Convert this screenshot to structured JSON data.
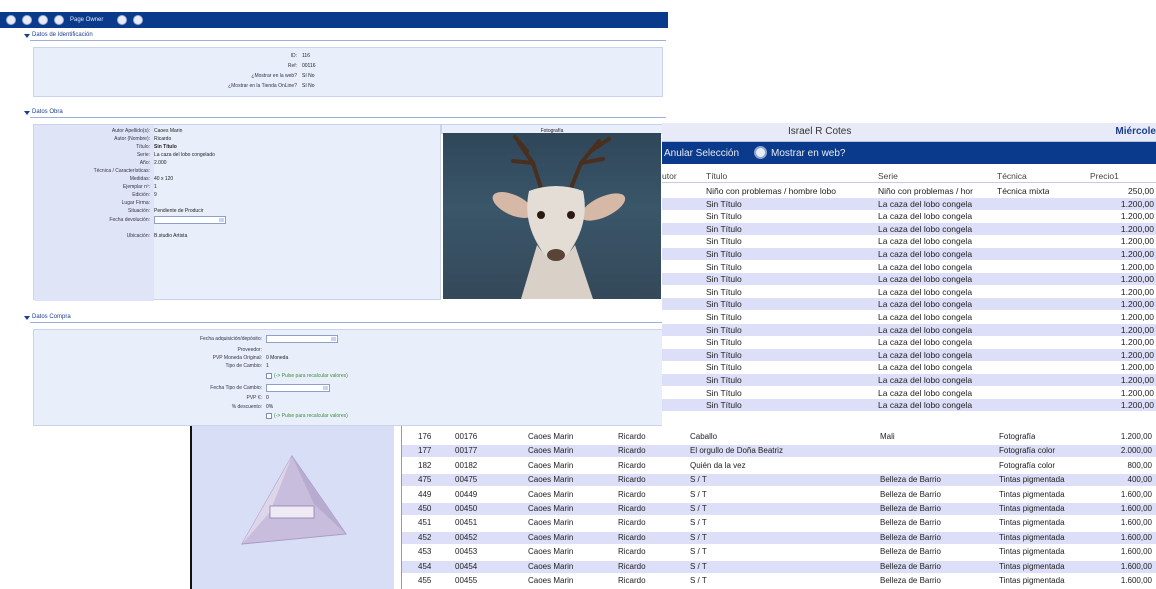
{
  "form": {
    "toolbar": {
      "page_label": "Page Owner"
    },
    "identification": {
      "title": "Datos de Identificación",
      "fields": [
        {
          "label": "ID:",
          "value": "116"
        },
        {
          "label": "Ref:",
          "value": "00116"
        },
        {
          "label": "¿Mostrar en la web?",
          "value": "Sí  No"
        },
        {
          "label": "¿Mostrar en la Tienda OnLine?",
          "value": "Sí  No"
        }
      ]
    },
    "work": {
      "title": "Datos Obra",
      "fields": [
        {
          "label": "Autor Apellido(s):",
          "value": "Caoes Marin"
        },
        {
          "label": "Autor (Nombre):",
          "value": "Ricardo"
        },
        {
          "label": "Título:",
          "value": "Sin Título"
        },
        {
          "label": "Serie:",
          "value": "La caza del lobo congelado"
        },
        {
          "label": "Año:",
          "value": "2.000"
        },
        {
          "label": "Técnica / Características:",
          "value": ""
        },
        {
          "label": "Medidas:",
          "value": "40 x 120"
        },
        {
          "label": "Ejemplar nº:",
          "value": "1"
        },
        {
          "label": "Edición:",
          "value": "9"
        },
        {
          "label": "Lugar Firma:",
          "value": ""
        },
        {
          "label": "Situación:",
          "value": "Pendiente de Producir"
        },
        {
          "label": "Fecha devolución:",
          "value": ""
        },
        {
          "label": "Ubicación:",
          "value": "B.studio Artista"
        }
      ],
      "photo_header": "Fotografía"
    },
    "purchase": {
      "title": "Datos Compra",
      "fields": [
        {
          "label": "Fecha adquisición/depósito:",
          "value": ""
        },
        {
          "label": "Proveedor:",
          "value": ""
        },
        {
          "label": "PVP Moneda Original:",
          "value": "0 Moneda"
        },
        {
          "label": "Tipo de Cambio:",
          "value": "1"
        },
        {
          "label": "",
          "value": "(-> Pulse para recalcular valores)"
        },
        {
          "label": "Fecha Tipo de Cambio:",
          "value": ""
        },
        {
          "label": "PVP €:",
          "value": "0"
        },
        {
          "label": "% descuento:",
          "value": "0%"
        },
        {
          "label": "",
          "value": "(-> Pulse para recalcular valores)"
        }
      ]
    }
  },
  "grid": {
    "user": "Israel R Cotes",
    "day": "Miércole",
    "toolbar": {
      "clear_label": "Anular Selección",
      "web_label": "Mostrar en web?"
    },
    "columns": [
      "utor",
      "Título",
      "Serie",
      "Técnica",
      "Precio1"
    ],
    "rows": [
      {
        "titulo": "Niño con problemas / hombre lobo",
        "serie": "Niño con problemas / hor",
        "tecnica": "Técnica mixta",
        "precio": "250,00"
      },
      {
        "titulo": "Sin Título",
        "serie": "La caza del lobo congela",
        "tecnica": "",
        "precio": "1.200,00"
      },
      {
        "titulo": "Sin Título",
        "serie": "La caza del lobo congela",
        "tecnica": "",
        "precio": "1.200,00"
      },
      {
        "titulo": "Sin Título",
        "serie": "La caza del lobo congela",
        "tecnica": "",
        "precio": "1.200,00"
      },
      {
        "titulo": "Sin Título",
        "serie": "La caza del lobo congela",
        "tecnica": "",
        "precio": "1.200,00"
      },
      {
        "titulo": "Sin Título",
        "serie": "La caza del lobo congela",
        "tecnica": "",
        "precio": "1.200,00"
      },
      {
        "titulo": "Sin Título",
        "serie": "La caza del lobo congela",
        "tecnica": "",
        "precio": "1.200,00"
      },
      {
        "titulo": "Sin Título",
        "serie": "La caza del lobo congela",
        "tecnica": "",
        "precio": "1.200,00"
      },
      {
        "titulo": "Sin Título",
        "serie": "La caza del lobo congela",
        "tecnica": "",
        "precio": "1.200,00"
      },
      {
        "titulo": "Sin Título",
        "serie": "La caza del lobo congela",
        "tecnica": "",
        "precio": "1.200,00"
      },
      {
        "titulo": "Sin Título",
        "serie": "La caza del lobo congela",
        "tecnica": "",
        "precio": "1.200,00"
      },
      {
        "titulo": "Sin Título",
        "serie": "La caza del lobo congela",
        "tecnica": "",
        "precio": "1.200,00"
      },
      {
        "titulo": "Sin Título",
        "serie": "La caza del lobo congela",
        "tecnica": "",
        "precio": "1.200,00"
      },
      {
        "titulo": "Sin Título",
        "serie": "La caza del lobo congela",
        "tecnica": "",
        "precio": "1.200,00"
      },
      {
        "titulo": "Sin Título",
        "serie": "La caza del lobo congela",
        "tecnica": "",
        "precio": "1.200,00"
      },
      {
        "titulo": "Sin Título",
        "serie": "La caza del lobo congela",
        "tecnica": "",
        "precio": "1.200,00"
      },
      {
        "titulo": "Sin Título",
        "serie": "La caza del lobo congela",
        "tecnica": "",
        "precio": "1.200,00"
      },
      {
        "titulo": "Sin Título",
        "serie": "La caza del lobo congela",
        "tecnica": "",
        "precio": "1.200,00"
      }
    ]
  },
  "table": {
    "rows": [
      {
        "id": "176",
        "ref": "00176",
        "apellido": "Caoes Marin",
        "nombre": "Ricardo",
        "titulo": "Caballo",
        "serie": "Mali",
        "tecnica": "Fotografía",
        "precio": "1.200,00"
      },
      {
        "id": "177",
        "ref": "00177",
        "apellido": "Caoes Marin",
        "nombre": "Ricardo",
        "titulo": "El orgullo de Doña Beatriz",
        "serie": "",
        "tecnica": "Fotografía color",
        "precio": "2.000,00"
      },
      {
        "id": "182",
        "ref": "00182",
        "apellido": "Caoes Marin",
        "nombre": "Ricardo",
        "titulo": "Quién da la vez",
        "serie": "",
        "tecnica": "Fotografía color",
        "precio": "800,00"
      },
      {
        "id": "475",
        "ref": "00475",
        "apellido": "Caoes Marin",
        "nombre": "Ricardo",
        "titulo": "S / T",
        "serie": "Belleza de Barrio",
        "tecnica": "Tintas pigmentada",
        "precio": "400,00"
      },
      {
        "id": "449",
        "ref": "00449",
        "apellido": "Caoes Marin",
        "nombre": "Ricardo",
        "titulo": "S / T",
        "serie": "Belleza de Barrio",
        "tecnica": "Tintas pigmentada",
        "precio": "1.600,00"
      },
      {
        "id": "450",
        "ref": "00450",
        "apellido": "Caoes Marin",
        "nombre": "Ricardo",
        "titulo": "S / T",
        "serie": "Belleza de Barrio",
        "tecnica": "Tintas pigmentada",
        "precio": "1.600,00"
      },
      {
        "id": "451",
        "ref": "00451",
        "apellido": "Caoes Marin",
        "nombre": "Ricardo",
        "titulo": "S / T",
        "serie": "Belleza de Barrio",
        "tecnica": "Tintas pigmentada",
        "precio": "1.600,00"
      },
      {
        "id": "452",
        "ref": "00452",
        "apellido": "Caoes Marin",
        "nombre": "Ricardo",
        "titulo": "S / T",
        "serie": "Belleza de Barrio",
        "tecnica": "Tintas pigmentada",
        "precio": "1.600,00"
      },
      {
        "id": "453",
        "ref": "00453",
        "apellido": "Caoes Marin",
        "nombre": "Ricardo",
        "titulo": "S / T",
        "serie": "Belleza de Barrio",
        "tecnica": "Tintas pigmentada",
        "precio": "1.600,00"
      },
      {
        "id": "454",
        "ref": "00454",
        "apellido": "Caoes Marin",
        "nombre": "Ricardo",
        "titulo": "S / T",
        "serie": "Belleza de Barrio",
        "tecnica": "Tintas pigmentada",
        "precio": "1.600,00"
      },
      {
        "id": "455",
        "ref": "00455",
        "apellido": "Caoes Marin",
        "nombre": "Ricardo",
        "titulo": "S / T",
        "serie": "Belleza de Barrio",
        "tecnica": "Tintas pigmentada",
        "precio": "1.600,00"
      }
    ]
  },
  "colors": {
    "toolbar_blue": "#0a3a8c",
    "row_alt": "#dcdff7",
    "panel_bg": "#e9eefb"
  }
}
